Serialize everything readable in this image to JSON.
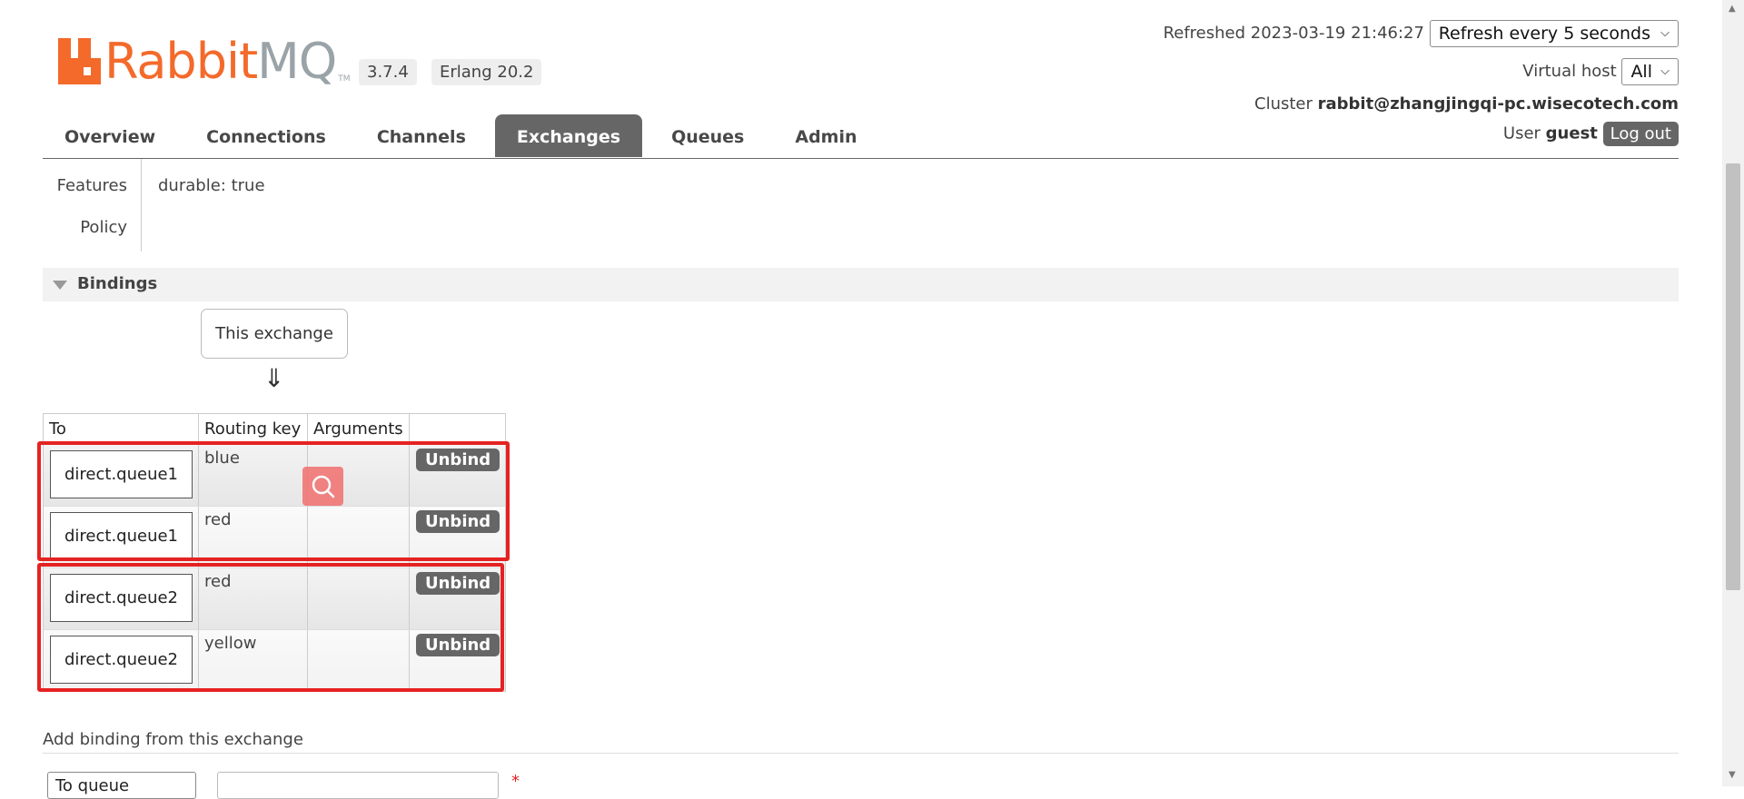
{
  "header": {
    "logo_prefix": "Rabbit",
    "logo_suffix": "MQ",
    "logo_tm": "TM",
    "version": "3.7.4",
    "erlang": "Erlang 20.2",
    "refreshed_label": "Refreshed",
    "refreshed_time": "2023-03-19 21:46:27",
    "refresh_select": "Refresh every 5 seconds",
    "vhost_label": "Virtual host",
    "vhost_value": "All",
    "cluster_label": "Cluster",
    "cluster_value": "rabbit@zhangjingqi-pc.wisecotech.com",
    "user_label": "User",
    "user_value": "guest",
    "logout": "Log out"
  },
  "nav": {
    "tabs": [
      {
        "label": "Overview"
      },
      {
        "label": "Connections"
      },
      {
        "label": "Channels"
      },
      {
        "label": "Exchanges",
        "active": true
      },
      {
        "label": "Queues"
      },
      {
        "label": "Admin"
      }
    ]
  },
  "details": {
    "features_label": "Features",
    "features_key": "durable:",
    "features_value": "true",
    "policy_label": "Policy"
  },
  "bindings": {
    "title": "Bindings",
    "this_exchange": "This exchange",
    "arrow": "⇓",
    "columns": [
      "To",
      "Routing key",
      "Arguments",
      ""
    ],
    "rows": [
      {
        "to": "direct.queue1",
        "routing_key": "blue",
        "unbind": "Unbind"
      },
      {
        "to": "direct.queue1",
        "routing_key": "red",
        "unbind": "Unbind"
      },
      {
        "to": "direct.queue2",
        "routing_key": "red",
        "unbind": "Unbind"
      },
      {
        "to": "direct.queue2",
        "routing_key": "yellow",
        "unbind": "Unbind"
      }
    ]
  },
  "add_binding": {
    "title": "Add binding from this exchange",
    "dest_select": "To queue",
    "required_mark": "*"
  },
  "colors": {
    "brand_orange": "#f36a2b",
    "highlight_red": "#e52222",
    "tab_active": "#666666"
  },
  "icons": [
    "search-icon",
    "chevron-down-icon",
    "collapse-triangle-icon"
  ]
}
